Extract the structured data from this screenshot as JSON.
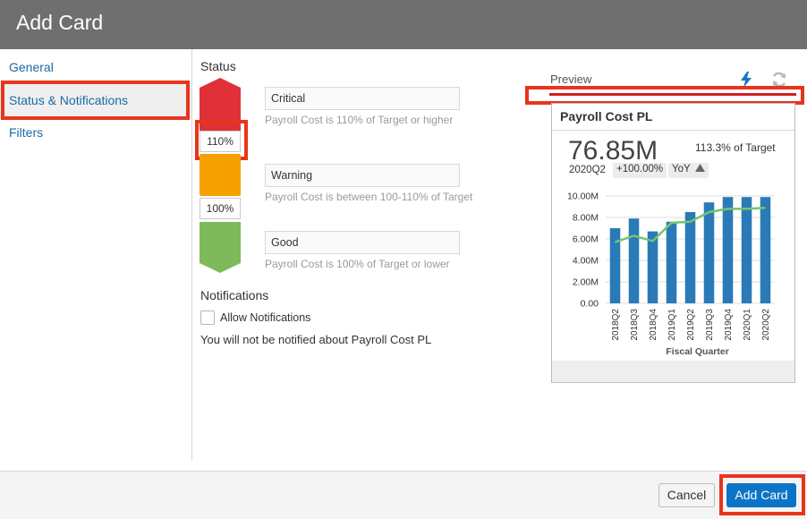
{
  "dialog": {
    "title": "Add Card"
  },
  "sidebar": {
    "items": [
      {
        "label": "General"
      },
      {
        "label": "Status & Notifications"
      },
      {
        "label": "Filters"
      }
    ]
  },
  "status": {
    "heading": "Status",
    "levels": [
      {
        "name": "Critical",
        "help": "Payroll Cost is 110% of Target or higher",
        "color": "#e03038"
      },
      {
        "name": "Warning",
        "help": "Payroll Cost is between 100-110% of Target",
        "color": "#f7a100"
      },
      {
        "name": "Good",
        "help": "Payroll Cost is 100% of Target or lower",
        "color": "#7fba5a"
      }
    ],
    "thresholds": [
      "110%",
      "100%"
    ]
  },
  "notifications": {
    "heading": "Notifications",
    "checkbox_label": "Allow Notifications",
    "checked": false,
    "message": "You will not be notified about Payroll Cost PL"
  },
  "preview": {
    "label": "Preview",
    "icons": {
      "quick": "lightning-icon",
      "refresh": "refresh-icon"
    },
    "card": {
      "title": "Payroll Cost PL",
      "value": "76.85M",
      "target_text": "113.3% of Target",
      "period": "2020Q2",
      "change": "+100.00%",
      "comparison": "YoY"
    }
  },
  "chart_data": {
    "type": "bar",
    "categories": [
      "2018Q2",
      "2018Q3",
      "2018Q4",
      "2019Q1",
      "2019Q2",
      "2019Q3",
      "2019Q4",
      "2020Q1",
      "2020Q2"
    ],
    "series": [
      {
        "type": "bar",
        "values": [
          7.0,
          7.9,
          6.7,
          7.6,
          8.5,
          9.4,
          9.9,
          9.9,
          9.9
        ],
        "color": "#2a7ab8"
      },
      {
        "type": "line",
        "values": [
          5.7,
          6.3,
          5.8,
          7.5,
          7.6,
          8.5,
          8.8,
          8.8,
          8.9
        ],
        "color": "#74c46e"
      }
    ],
    "ylim": [
      0,
      10
    ],
    "yticks": [
      "0.00",
      "2.00M",
      "4.00M",
      "6.00M",
      "8.00M",
      "10.00M"
    ],
    "xlabel": "Fiscal Quarter",
    "ylabel": ""
  },
  "footer": {
    "cancel_label": "Cancel",
    "add_label": "Add Card"
  }
}
